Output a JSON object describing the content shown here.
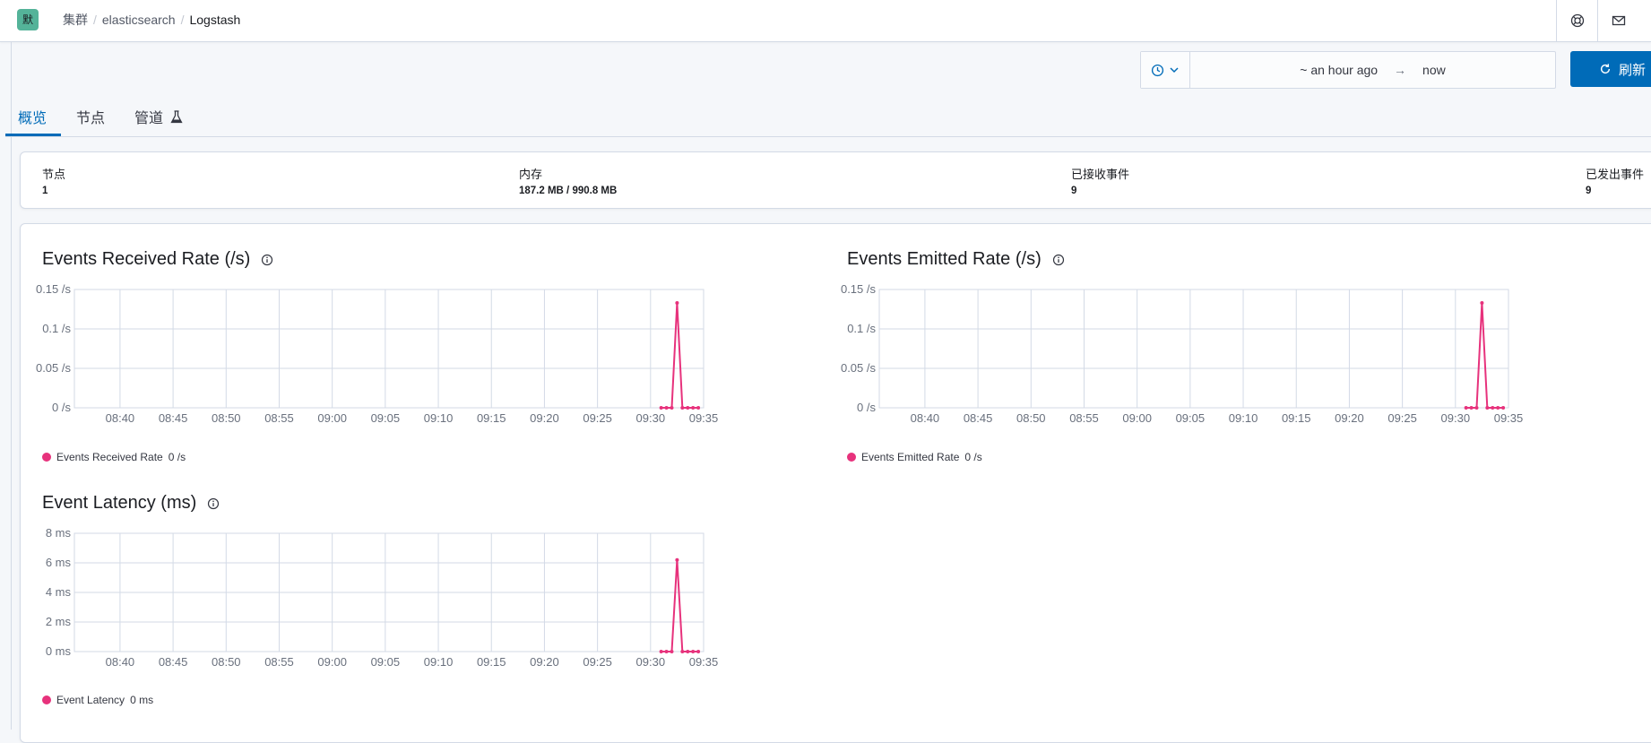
{
  "header": {
    "logo_text": "默",
    "breadcrumbs": [
      "集群",
      "elasticsearch",
      "Logstash"
    ],
    "help_icon": "lifebuoy-icon",
    "mail_icon": "mail-icon"
  },
  "time_picker": {
    "quick_icon": "clock-icon",
    "start": "~ an hour ago",
    "arrow": "→",
    "end": "now",
    "refresh_label": "刷新",
    "refresh_icon": "refresh-icon"
  },
  "tabs": [
    {
      "label": "概览",
      "active": true
    },
    {
      "label": "节点",
      "active": false
    },
    {
      "label": "管道",
      "active": false,
      "icon": "beaker-icon"
    }
  ],
  "stats": [
    {
      "label": "节点",
      "value": "1"
    },
    {
      "label": "内存",
      "value": "187.2 MB / 990.8 MB"
    },
    {
      "label": "已接收事件",
      "value": "9"
    },
    {
      "label": "已发出事件",
      "value": "9"
    }
  ],
  "colors": {
    "accent": "#006bb8",
    "series": "#e7327c",
    "grid": "#d3dae6"
  },
  "chart_data": [
    {
      "type": "line",
      "title": "Events Received Rate (/s)",
      "legend": {
        "name": "Events Received Rate",
        "value": "0 /s"
      },
      "y_ticks": [
        "0.15 /s",
        "0.1 /s",
        "0.05 /s",
        "0 /s"
      ],
      "ylim": [
        0,
        0.15
      ],
      "x_ticks": [
        "08:40",
        "08:45",
        "08:50",
        "08:55",
        "09:00",
        "09:05",
        "09:10",
        "09:15",
        "09:20",
        "09:25",
        "09:30",
        "09:35"
      ],
      "x": [
        "09:31:00",
        "09:31:30",
        "09:32:00",
        "09:32:30",
        "09:33:00",
        "09:33:30",
        "09:34:00",
        "09:34:30"
      ],
      "series": [
        {
          "name": "Events Received Rate",
          "values": [
            0,
            0,
            0,
            0.133,
            0,
            0,
            0,
            0
          ]
        }
      ]
    },
    {
      "type": "line",
      "title": "Events Emitted Rate (/s)",
      "legend": {
        "name": "Events Emitted Rate",
        "value": "0 /s"
      },
      "y_ticks": [
        "0.15 /s",
        "0.1 /s",
        "0.05 /s",
        "0 /s"
      ],
      "ylim": [
        0,
        0.15
      ],
      "x_ticks": [
        "08:40",
        "08:45",
        "08:50",
        "08:55",
        "09:00",
        "09:05",
        "09:10",
        "09:15",
        "09:20",
        "09:25",
        "09:30",
        "09:35"
      ],
      "x": [
        "09:31:00",
        "09:31:30",
        "09:32:00",
        "09:32:30",
        "09:33:00",
        "09:33:30",
        "09:34:00",
        "09:34:30"
      ],
      "series": [
        {
          "name": "Events Emitted Rate",
          "values": [
            0,
            0,
            0,
            0.133,
            0,
            0,
            0,
            0
          ]
        }
      ]
    },
    {
      "type": "line",
      "title": "Event Latency (ms)",
      "legend": {
        "name": "Event Latency",
        "value": "0 ms"
      },
      "y_ticks": [
        "8 ms",
        "6 ms",
        "4 ms",
        "2 ms",
        "0 ms"
      ],
      "ylim": [
        0,
        8
      ],
      "x_ticks": [
        "08:40",
        "08:45",
        "08:50",
        "08:55",
        "09:00",
        "09:05",
        "09:10",
        "09:15",
        "09:20",
        "09:25",
        "09:30",
        "09:35"
      ],
      "x": [
        "09:31:00",
        "09:31:30",
        "09:32:00",
        "09:32:30",
        "09:33:00",
        "09:33:30",
        "09:34:00",
        "09:34:30"
      ],
      "series": [
        {
          "name": "Event Latency",
          "values": [
            0,
            0,
            0,
            6.2,
            0,
            0,
            0,
            0
          ]
        }
      ]
    }
  ]
}
